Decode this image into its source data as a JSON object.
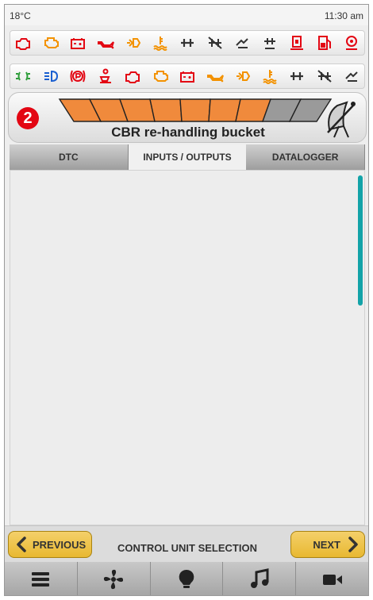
{
  "status": {
    "temperature": "18°C",
    "time": "11:30 am"
  },
  "warnings_row1": [
    {
      "icon": "engine-warning-icon",
      "color": "#e30613"
    },
    {
      "icon": "engine-check-icon",
      "color": "#f39200"
    },
    {
      "icon": "battery-icon",
      "color": "#e30613"
    },
    {
      "icon": "oil-pressure-icon",
      "color": "#e30613"
    },
    {
      "icon": "transmission-icon",
      "color": "#f39200"
    },
    {
      "icon": "coolant-temperature-icon",
      "color": "#f39200"
    },
    {
      "icon": "axle-icon",
      "color": "#333333"
    },
    {
      "icon": "axle-disabled-icon",
      "color": "#333333"
    },
    {
      "icon": "hydraulic-icon",
      "color": "#333333"
    },
    {
      "icon": "axle-ack-icon",
      "color": "#333333"
    },
    {
      "icon": "fuel-filter-icon",
      "color": "#e30613"
    },
    {
      "icon": "fuel-level-icon",
      "color": "#e30613"
    },
    {
      "icon": "seat-belt-icon",
      "color": "#e30613"
    }
  ],
  "warnings_row2": [
    {
      "icon": "side-lights-icon",
      "color": "#2e9d3a"
    },
    {
      "icon": "high-beam-icon",
      "color": "#1a5fd0"
    },
    {
      "icon": "parking-brake-icon",
      "color": "#e30613"
    },
    {
      "icon": "operator-presence-icon",
      "color": "#e30613"
    },
    {
      "icon": "engine-warning-icon",
      "color": "#e30613"
    },
    {
      "icon": "engine-check-icon",
      "color": "#f39200"
    },
    {
      "icon": "battery-icon",
      "color": "#e30613"
    },
    {
      "icon": "oil-pressure-icon",
      "color": "#f39200"
    },
    {
      "icon": "transmission-icon",
      "color": "#f39200"
    },
    {
      "icon": "coolant-temperature-icon",
      "color": "#f39200"
    },
    {
      "icon": "axle-icon",
      "color": "#333333"
    },
    {
      "icon": "axle-disabled-icon",
      "color": "#333333"
    },
    {
      "icon": "hydraulic-icon",
      "color": "#333333"
    }
  ],
  "vehicle": {
    "step_number": "2",
    "name": "CBR re-handling bucket",
    "gauge_filled_segments": 7,
    "gauge_total_segments": 9,
    "gauge_color": "#f08a3c"
  },
  "tabs": [
    {
      "label": "DTC",
      "active": false
    },
    {
      "label": "INPUTS / OUTPUTS",
      "active": true
    },
    {
      "label": "DATALOGGER",
      "active": false
    }
  ],
  "scroll": {
    "position_fraction": 0.0,
    "visible_fraction": 0.38,
    "accent": "#13a3a8"
  },
  "navigation": {
    "previous_label": "PREVIOUS",
    "title": "CONTROL UNIT SELECTION",
    "next_label": "NEXT",
    "button_color": "#e8b831"
  },
  "bottom_bar": [
    {
      "icon": "menu-icon"
    },
    {
      "icon": "fan-icon"
    },
    {
      "icon": "light-bulb-icon"
    },
    {
      "icon": "music-note-icon"
    },
    {
      "icon": "video-camera-icon"
    }
  ]
}
